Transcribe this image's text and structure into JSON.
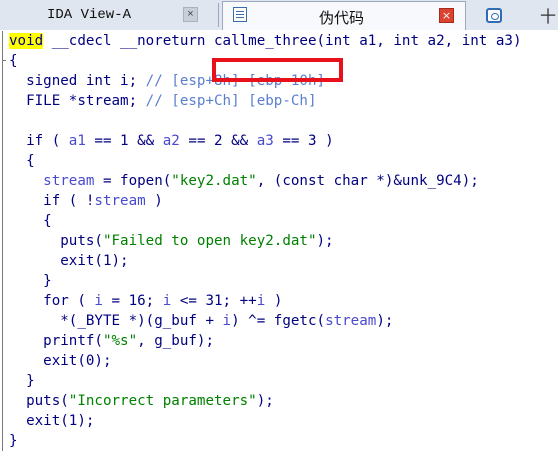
{
  "tabs": {
    "ida_view": "IDA View-A",
    "ida_view_close": "×",
    "pseudocode": "伪代码",
    "pseudocode_close": "×",
    "hex_icon": "hex-view-icon",
    "more": "十"
  },
  "code": [
    {
      "parts": [
        {
          "t": "void",
          "c": "kw hl"
        },
        {
          "t": " __cdecl __noreturn callme_three(int a1, int a2, int a3)",
          "c": "kw"
        }
      ]
    },
    {
      "parts": [
        {
          "t": "{",
          "c": "kw"
        }
      ]
    },
    {
      "parts": [
        {
          "t": "  signed int i; ",
          "c": "kw"
        },
        {
          "t": "// [esp+8h] [ebp-10h]",
          "c": "cmt"
        }
      ]
    },
    {
      "parts": [
        {
          "t": "  FILE *stream; ",
          "c": "kw"
        },
        {
          "t": "// [esp+Ch] [ebp-Ch]",
          "c": "cmt"
        }
      ]
    },
    {
      "parts": [
        {
          "t": "",
          "c": "kw"
        }
      ]
    },
    {
      "parts": [
        {
          "t": "  if ( ",
          "c": "kw"
        },
        {
          "t": "a1",
          "c": "var"
        },
        {
          "t": " == 1 && ",
          "c": "kw"
        },
        {
          "t": "a2",
          "c": "var"
        },
        {
          "t": " == 2 && ",
          "c": "kw"
        },
        {
          "t": "a3",
          "c": "var"
        },
        {
          "t": " == 3 )",
          "c": "kw"
        }
      ]
    },
    {
      "parts": [
        {
          "t": "  {",
          "c": "kw"
        }
      ]
    },
    {
      "parts": [
        {
          "t": "    ",
          "c": "kw"
        },
        {
          "t": "stream",
          "c": "var"
        },
        {
          "t": " = fopen(",
          "c": "kw"
        },
        {
          "t": "\"key2.dat\"",
          "c": "str"
        },
        {
          "t": ", (const char *)&unk_9C4);",
          "c": "kw"
        }
      ]
    },
    {
      "parts": [
        {
          "t": "    if ( !",
          "c": "kw"
        },
        {
          "t": "stream",
          "c": "var"
        },
        {
          "t": " )",
          "c": "kw"
        }
      ]
    },
    {
      "parts": [
        {
          "t": "    {",
          "c": "kw"
        }
      ]
    },
    {
      "parts": [
        {
          "t": "      puts(",
          "c": "kw"
        },
        {
          "t": "\"Failed to open key2.dat\"",
          "c": "str"
        },
        {
          "t": ");",
          "c": "kw"
        }
      ]
    },
    {
      "parts": [
        {
          "t": "      exit(1);",
          "c": "kw"
        }
      ]
    },
    {
      "parts": [
        {
          "t": "    }",
          "c": "kw"
        }
      ]
    },
    {
      "parts": [
        {
          "t": "    for ( ",
          "c": "kw"
        },
        {
          "t": "i",
          "c": "var"
        },
        {
          "t": " = 16; ",
          "c": "kw"
        },
        {
          "t": "i",
          "c": "var"
        },
        {
          "t": " <= 31; ++",
          "c": "kw"
        },
        {
          "t": "i",
          "c": "var"
        },
        {
          "t": " )",
          "c": "kw"
        }
      ]
    },
    {
      "parts": [
        {
          "t": "      *(_BYTE *)(g_buf + ",
          "c": "kw"
        },
        {
          "t": "i",
          "c": "var"
        },
        {
          "t": ") ^= fgetc(",
          "c": "kw"
        },
        {
          "t": "stream",
          "c": "var"
        },
        {
          "t": ");",
          "c": "kw"
        }
      ]
    },
    {
      "parts": [
        {
          "t": "    printf(",
          "c": "kw"
        },
        {
          "t": "\"%s\"",
          "c": "str"
        },
        {
          "t": ", g_buf);",
          "c": "kw"
        }
      ]
    },
    {
      "parts": [
        {
          "t": "    exit(0);",
          "c": "kw"
        }
      ]
    },
    {
      "parts": [
        {
          "t": "  }",
          "c": "kw"
        }
      ]
    },
    {
      "parts": [
        {
          "t": "  puts(",
          "c": "kw"
        },
        {
          "t": "\"Incorrect parameters\"",
          "c": "str"
        },
        {
          "t": ");",
          "c": "kw"
        }
      ]
    },
    {
      "parts": [
        {
          "t": "  exit(1);",
          "c": "kw"
        }
      ]
    },
    {
      "parts": [
        {
          "t": "}",
          "c": "kw"
        }
      ]
    }
  ],
  "colors": {
    "keyword": "#000080",
    "variable": "#4a4ad0",
    "comment": "#5a7fd0",
    "string": "#008000",
    "highlight": "#ffff00",
    "callout": "#e8101a"
  }
}
